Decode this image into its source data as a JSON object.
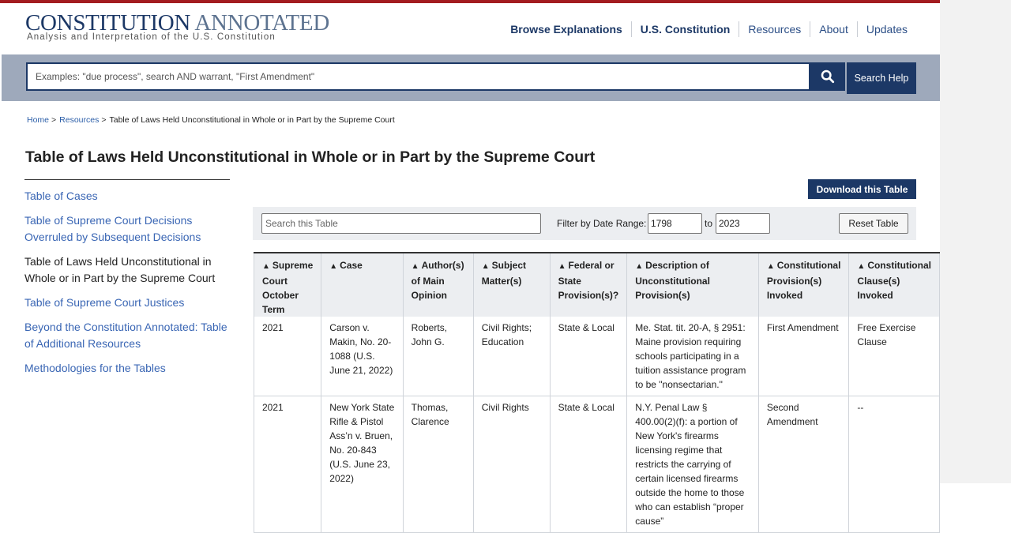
{
  "header": {
    "logo_main": "CONSTITUTION",
    "logo_light": "ANNOTATED",
    "logo_subtitle": "Analysis and Interpretation of the U.S. Constitution",
    "nav": [
      "Browse Explanations",
      "U.S. Constitution",
      "Resources",
      "About",
      "Updates"
    ]
  },
  "search": {
    "placeholder": "Examples: \"due process\", search AND warrant, \"First Amendment\"",
    "icon": "search-icon",
    "help_label": "Search Help"
  },
  "breadcrumb": {
    "home": "Home",
    "resources": "Resources",
    "current": "Table of Laws Held Unconstitutional in Whole or in Part by the Supreme Court",
    "separator": ">"
  },
  "page_title": "Table of Laws Held Unconstitutional in Whole or in Part by the Supreme Court",
  "sidebar": {
    "items": [
      "Table of Cases",
      "Table of Supreme Court Decisions Overruled by Subsequent Decisions",
      "Table of Laws Held Unconstitutional in Whole or in Part by the Supreme Court",
      "Table of Supreme Court Justices",
      "Beyond the Constitution Annotated: Table of Additional Resources",
      "Methodologies for the Tables"
    ],
    "current_index": 2
  },
  "toolbar": {
    "download_label": "Download this Table",
    "search_placeholder": "Search this Table",
    "filter_label": "Filter by Date Range:",
    "date_from": "1798",
    "to_label": "to",
    "date_to": "2023",
    "reset_label": "Reset Table",
    "sort_icon": "sort-icon"
  },
  "table": {
    "columns": [
      "Supreme Court October Term",
      "Case",
      "Author(s) of Main Opinion",
      "Subject Matter(s)",
      "Federal or State Provision(s)?",
      "Description of Unconstitutional Provision(s)",
      "Constitutional Provision(s) Invoked",
      "Constitutional Clause(s) Invoked"
    ],
    "rows": [
      {
        "term": "2021",
        "case": "Carson v. Makin, No. 20-1088 (U.S. June 21, 2022)",
        "author": "Roberts, John G.",
        "subject": "Civil Rights; Education",
        "fed_state": "State & Local",
        "description": "Me. Stat. tit. 20-A, § 2951: Maine provision requiring schools participating in a tuition assistance program to be \"nonsectarian.\"",
        "provision": "First Amendment",
        "clause": "Free Exercise Clause"
      },
      {
        "term": "2021",
        "case_name": "New York State Rifle & Pistol Ass’n v. Bruen,",
        "case_docket": "No. 20-843 (U.S. June 23, 2022)",
        "author": "Thomas, Clarence",
        "subject": "Civil Rights",
        "fed_state": "State & Local",
        "description": "N.Y. Penal Law § 400.00(2)(f): a portion of New York's firearms licensing regime that restricts the carrying of certain licensed firearms outside the home to those who can establish “proper cause”",
        "provision": "Second Amendment",
        "clause": "--"
      }
    ]
  }
}
